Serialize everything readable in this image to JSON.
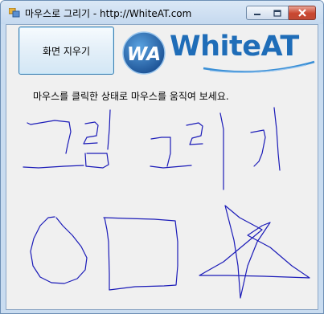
{
  "window": {
    "title": "마우스로 그리기 - http://WhiteAT.com",
    "controls": {
      "minimize": "minimize",
      "maximize": "maximize",
      "close": "close"
    }
  },
  "toolbar": {
    "clear_label": "화면 지우기"
  },
  "logo": {
    "mark_text": "WA",
    "brand_text": "WhiteAT",
    "colors": {
      "primary": "#1f6db8",
      "accent": "#3a8fd6"
    }
  },
  "instruction": "마우스를 클릭한 상태로 마우스를 움직여 보세요.",
  "colors": {
    "stroke": "#1b1bb8",
    "client_bg": "#f0f0f0",
    "titlebar": "#c9dcf0",
    "close_button": "#c9462f"
  }
}
